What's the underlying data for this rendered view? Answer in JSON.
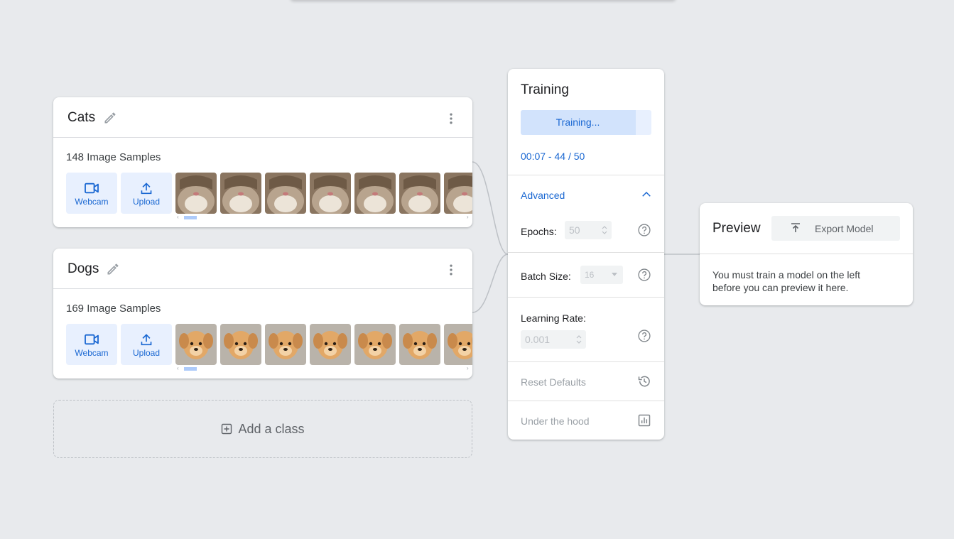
{
  "classes": [
    {
      "name": "Cats",
      "sample_count_label": "148 Image Samples",
      "webcam_label": "Webcam",
      "upload_label": "Upload",
      "thumbnail_subject": "cat",
      "thumbnail_count": 7
    },
    {
      "name": "Dogs",
      "sample_count_label": "169 Image Samples",
      "webcam_label": "Webcam",
      "upload_label": "Upload",
      "thumbnail_subject": "puppy",
      "thumbnail_count": 7
    }
  ],
  "add_class_label": "Add a class",
  "training": {
    "title": "Training",
    "button_label": "Training...",
    "progress_fraction": 0.88,
    "status": "00:07 - 44 / 50",
    "advanced_label": "Advanced",
    "epochs_label": "Epochs:",
    "epochs_value": "50",
    "batch_size_label": "Batch Size:",
    "batch_size_value": "16",
    "learning_rate_label": "Learning Rate:",
    "learning_rate_value": "0.001",
    "reset_label": "Reset Defaults",
    "under_hood_label": "Under the hood"
  },
  "preview": {
    "title": "Preview",
    "export_label": "Export Model",
    "message": "You must train a model on the left before you can preview it here."
  },
  "colors": {
    "accent": "#1967d2",
    "button_bg": "#e8f0fe",
    "background": "#e8eaed"
  }
}
